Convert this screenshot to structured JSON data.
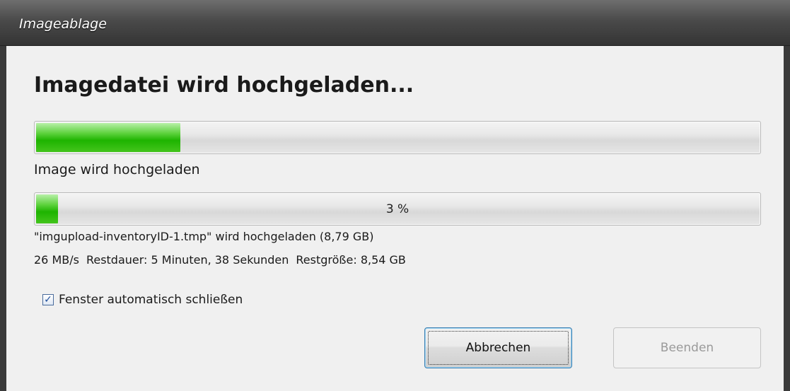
{
  "window": {
    "title": "Imageablage"
  },
  "dialog": {
    "heading": "Imagedatei wird hochgeladen...",
    "overall_progress": {
      "fraction": 0.2,
      "text": ""
    },
    "stage_label": "Image wird hochgeladen",
    "file_progress": {
      "fraction": 0.03,
      "text": "3 %"
    },
    "file_line": "\"imgupload-inventoryID-1.tmp\" wird hochgeladen (8,79 GB)",
    "stats": {
      "speed": "26 MB/s",
      "remaining_time": "Restdauer: 5 Minuten, 38 Sekunden",
      "remaining_size": "Restgröße: 8,54 GB"
    },
    "auto_close": {
      "label": "Fenster automatisch schließen",
      "checked": true
    },
    "buttons": {
      "cancel": "Abbrechen",
      "finish": "Beenden"
    }
  },
  "colors": {
    "progress_green": "#1eb400",
    "focus_border": "#3c7fb1",
    "disabled_text": "#9a9a9a"
  }
}
